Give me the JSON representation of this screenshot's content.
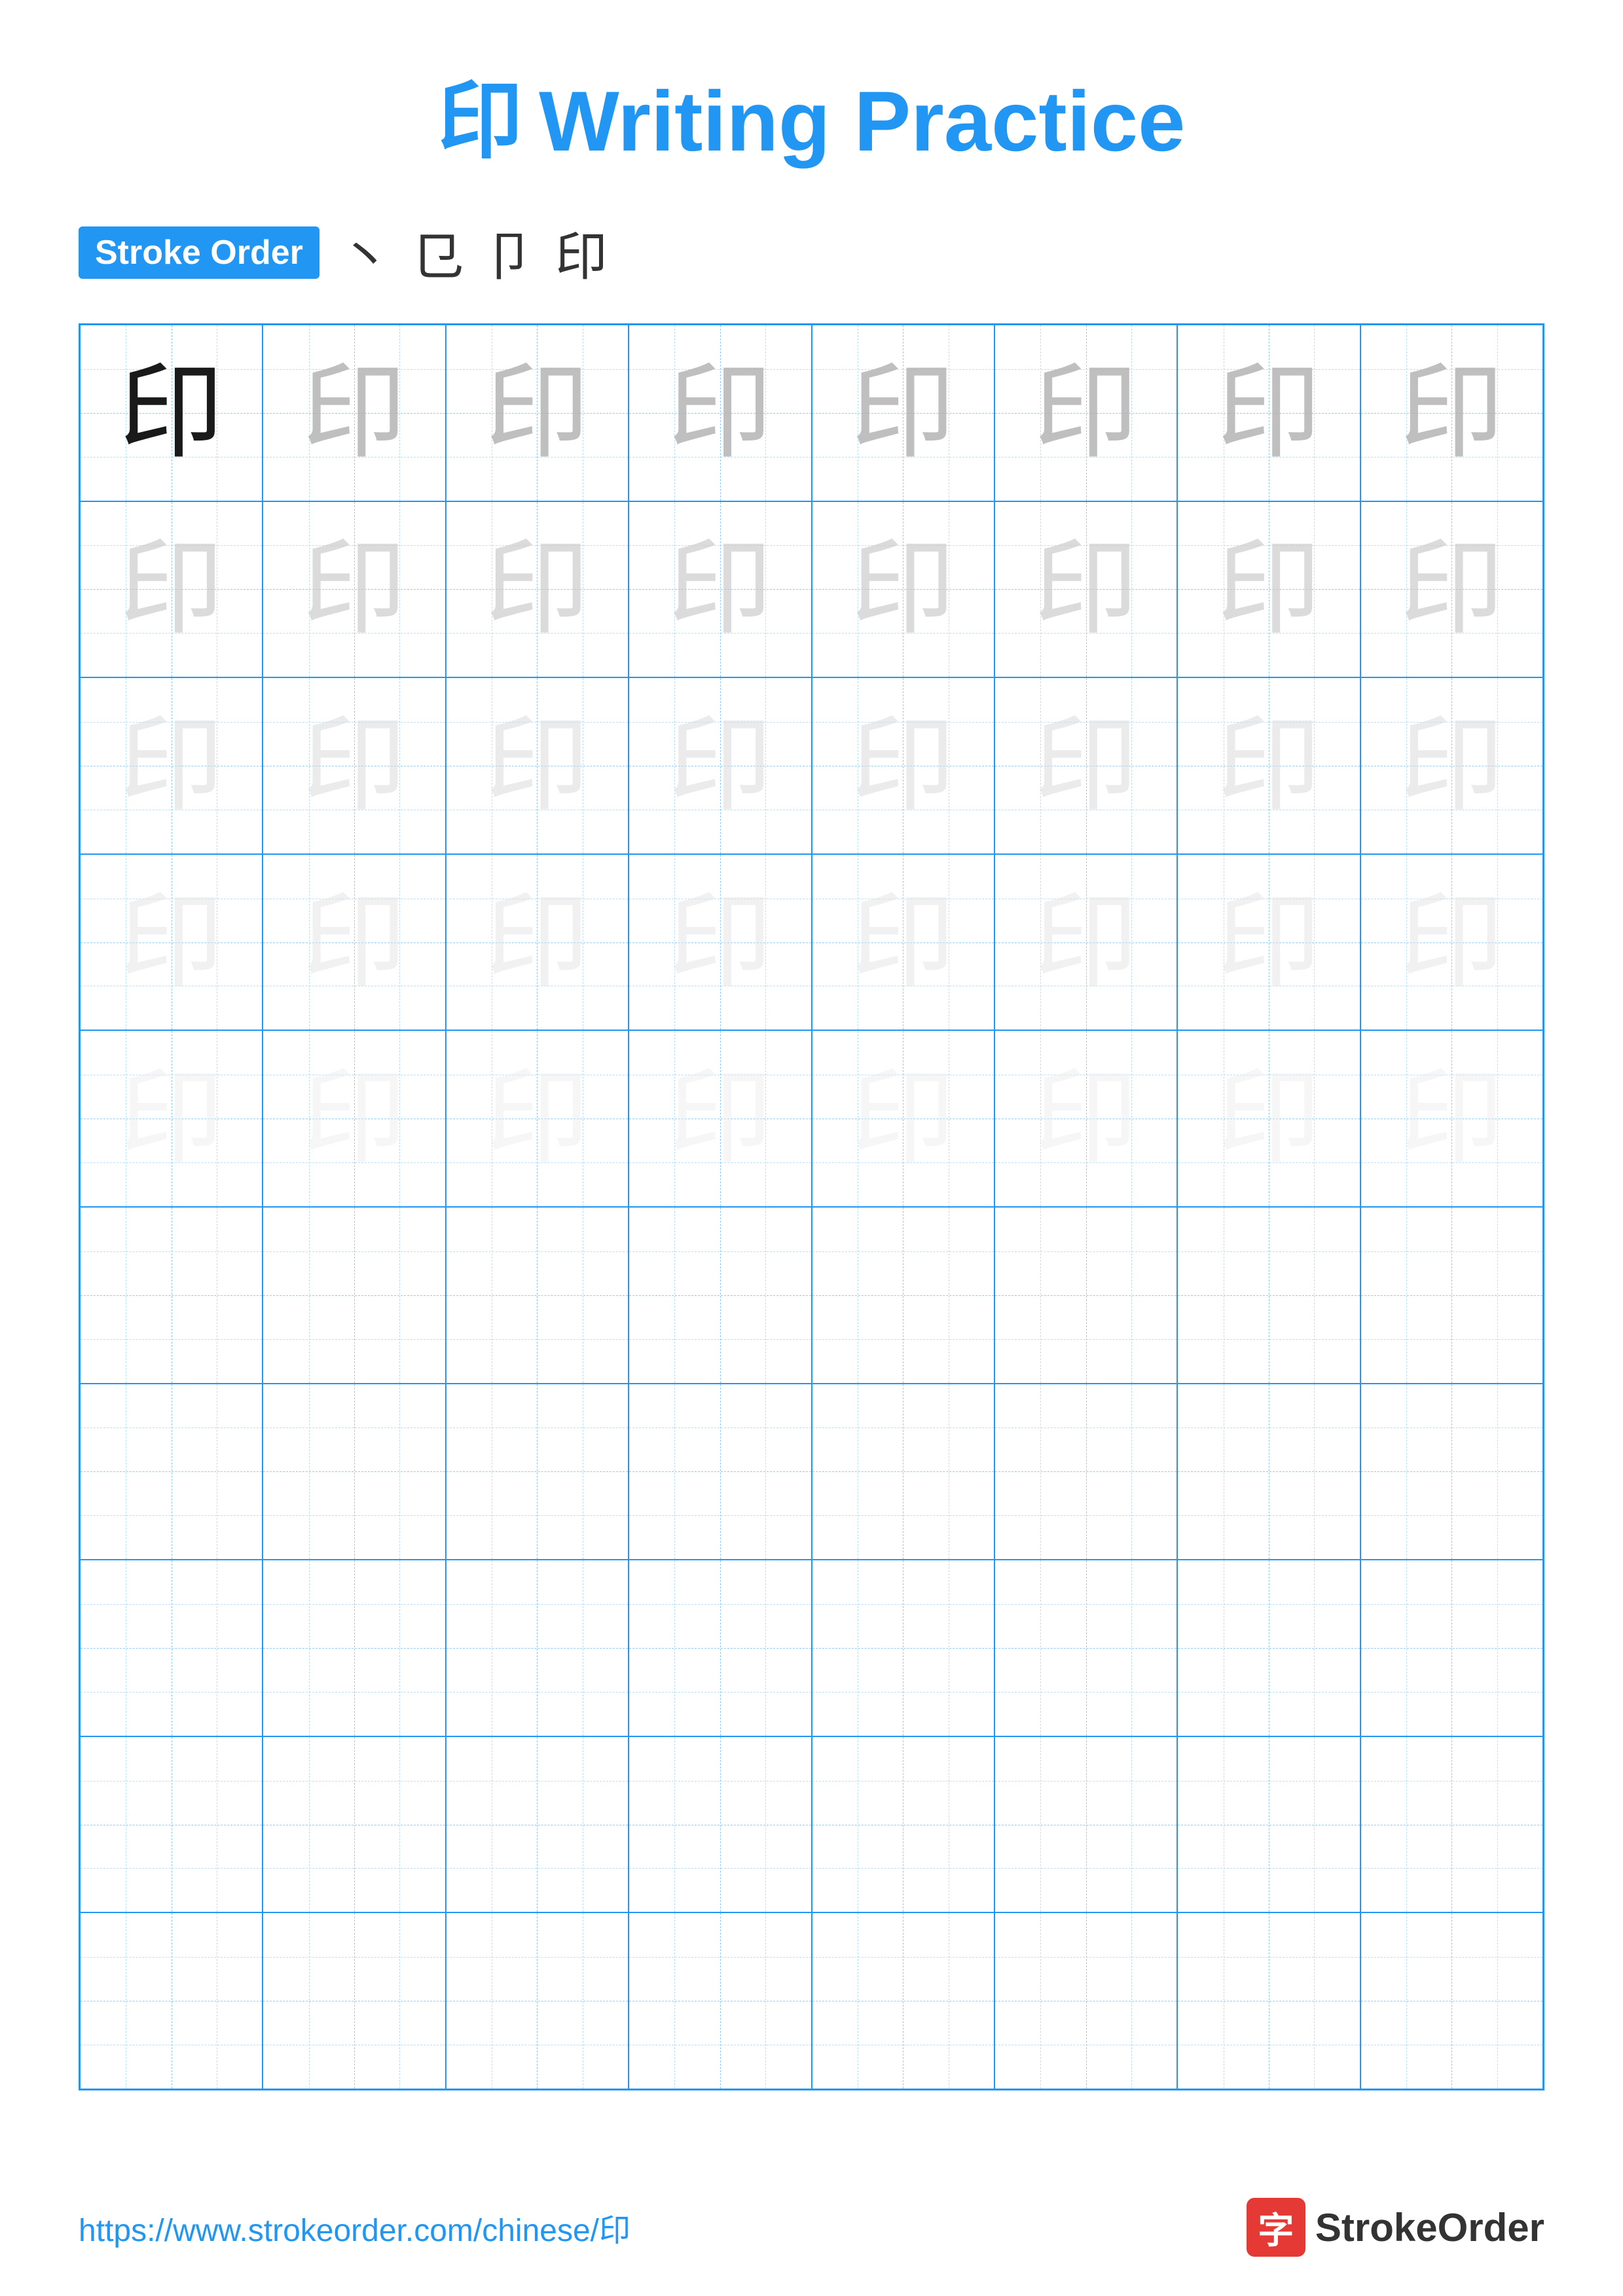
{
  "title": {
    "char": "印",
    "text": "Writing Practice"
  },
  "stroke_order": {
    "badge_label": "Stroke Order",
    "steps": [
      "丶",
      "㔾",
      "卩",
      "印"
    ]
  },
  "grid": {
    "rows": 10,
    "cols": 8,
    "char": "印",
    "filled_rows": 5,
    "empty_rows": 5
  },
  "footer": {
    "url": "https://www.strokeorder.com/chinese/印",
    "logo_char": "字",
    "logo_text": "StrokeOrder"
  }
}
